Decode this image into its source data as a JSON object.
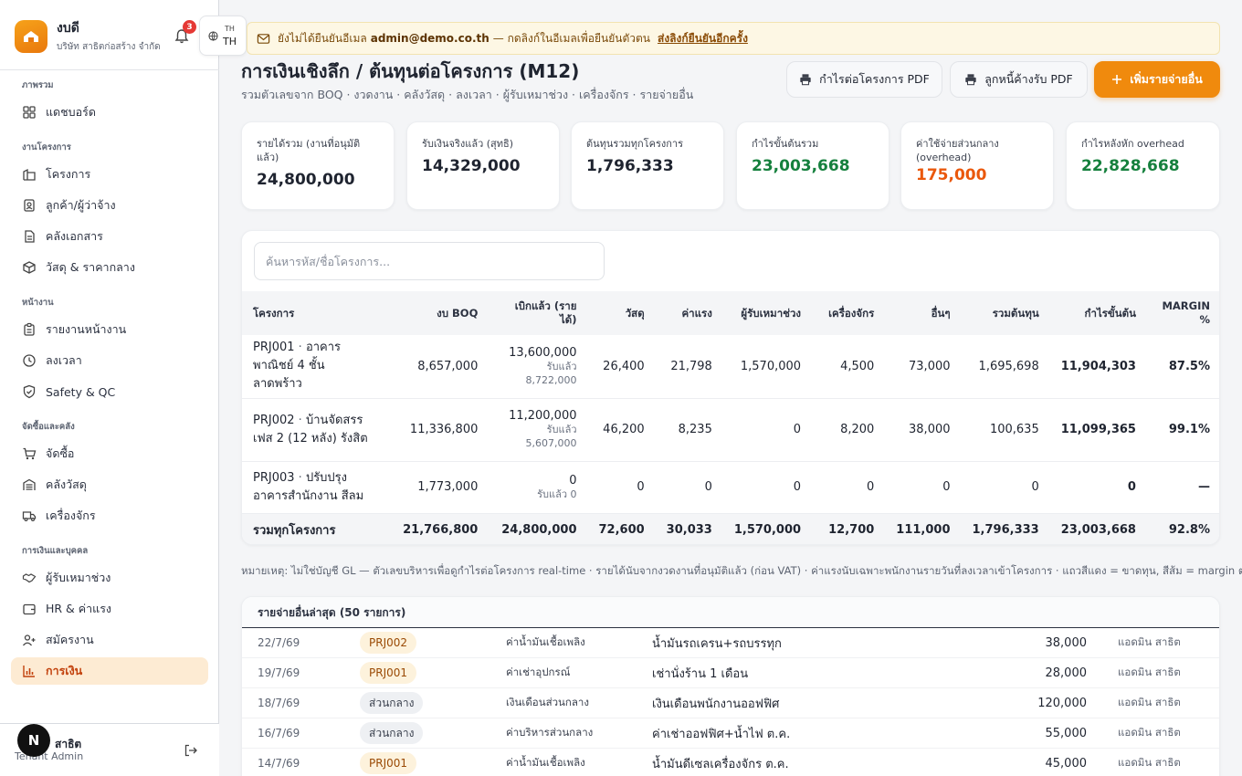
{
  "brand": {
    "name": "งบดี",
    "company": "บริษัท สาธิตก่อสร้าง จำกัด",
    "notification_count": "3"
  },
  "lang": {
    "top": "TH",
    "main": "TH"
  },
  "banner": {
    "text_before": "ยังไม่ได้ยืนยันอีเมล",
    "email": "admin@demo.co.th",
    "text_after": "— กดลิงก์ในอีเมลเพื่อยืนยันตัวตน",
    "link": "ส่งลิงก์ยืนยันอีกครั้ง"
  },
  "sidebar": {
    "sections": {
      "overview": "ภาพรวม",
      "projects": "งานโครงการ",
      "site": "หน้างาน",
      "procurement": "จัดซื้อและคลัง",
      "finance": "การเงินและบุคคล"
    },
    "items": {
      "dashboard": "แดชบอร์ด",
      "projects": "โครงการ",
      "clients": "ลูกค้า/ผู้ว่าจ้าง",
      "documents": "คลังเอกสาร",
      "materials": "วัสดุ & ราคากลาง",
      "daily_report": "รายงานหน้างาน",
      "timesheet": "ลงเวลา",
      "safety": "Safety & QC",
      "purchasing": "จัดซื้อ",
      "warehouse": "คลังวัสดุ",
      "machinery": "เครื่องจักร",
      "subcontractors": "ผู้รับเหมาช่วง",
      "hr": "HR & ค่าแรง",
      "recruit": "สมัครงาน",
      "finance": "การเงิน"
    },
    "user": {
      "initial": "N",
      "name": "สาธิต",
      "role": "Tenant Admin"
    }
  },
  "header": {
    "title": "การเงินเชิงลึก / ต้นทุนต่อโครงการ (M12)",
    "subtitle": "รวมตัวเลขจาก BOQ · งวดงาน · คลังวัสดุ · ลงเวลา · ผู้รับเหมาช่วง · เครื่องจักร · รายจ่ายอื่น",
    "btn_profit_pdf": "กำไรต่อโครงการ PDF",
    "btn_ar_pdf": "ลูกหนี้ค้างรับ PDF",
    "btn_add": "เพิ่มรายจ่ายอื่น"
  },
  "kpis": [
    {
      "label": "รายได้รวม (งานที่อนุมัติแล้ว)",
      "value": "24,800,000",
      "tone": ""
    },
    {
      "label": "รับเงินจริงแล้ว (สุทธิ)",
      "value": "14,329,000",
      "tone": ""
    },
    {
      "label": "ต้นทุนรวมทุกโครงการ",
      "value": "1,796,333",
      "tone": ""
    },
    {
      "label": "กำไรขั้นต้นรวม",
      "value": "23,003,668",
      "tone": "green"
    },
    {
      "label": "ค่าใช้จ่ายส่วนกลาง (overhead)",
      "value": "175,000",
      "tone": "orange"
    },
    {
      "label": "กำไรหลังหัก overhead",
      "value": "22,828,668",
      "tone": "green"
    }
  ],
  "search": {
    "placeholder": "ค้นหารหัส/ชื่อโครงการ..."
  },
  "table": {
    "headers": {
      "project": "โครงการ",
      "boq": "งบ BOQ",
      "billed": "เบิกแล้ว (รายได้)",
      "material": "วัสดุ",
      "labor": "ค่าแรง",
      "sub": "ผู้รับเหมาช่วง",
      "machine": "เครื่องจักร",
      "other": "อื่นๆ",
      "total_cost": "รวมต้นทุน",
      "gross": "กำไรขั้นต้น",
      "margin": "MARGIN %"
    },
    "rows": [
      {
        "code": "PRJ001",
        "name": "อาคารพาณิชย์ 4 ชั้น ลาดพร้าว",
        "boq": "8,657,000",
        "billed": "13,600,000",
        "received": "รับแล้ว 8,722,000",
        "material": "26,400",
        "labor": "21,798",
        "sub": "1,570,000",
        "machine": "4,500",
        "other": "73,000",
        "total_cost": "1,695,698",
        "gross": "11,904,303",
        "margin": "87.5%"
      },
      {
        "code": "PRJ002",
        "name": "บ้านจัดสรร เฟส 2 (12 หลัง) รังสิต",
        "boq": "11,336,800",
        "billed": "11,200,000",
        "received": "รับแล้ว 5,607,000",
        "material": "46,200",
        "labor": "8,235",
        "sub": "0",
        "machine": "8,200",
        "other": "38,000",
        "total_cost": "100,635",
        "gross": "11,099,365",
        "margin": "99.1%"
      },
      {
        "code": "PRJ003",
        "name": "ปรับปรุงอาคารสำนักงาน สีลม",
        "boq": "1,773,000",
        "billed": "0",
        "received": "รับแล้ว 0",
        "material": "0",
        "labor": "0",
        "sub": "0",
        "machine": "0",
        "other": "0",
        "total_cost": "0",
        "gross": "0",
        "margin": "—"
      }
    ],
    "total": {
      "label": "รวมทุกโครงการ",
      "boq": "21,766,800",
      "billed": "24,800,000",
      "material": "72,600",
      "labor": "30,033",
      "sub": "1,570,000",
      "machine": "12,700",
      "other": "111,000",
      "total_cost": "1,796,333",
      "gross": "23,003,668",
      "margin": "92.8%"
    }
  },
  "note": "หมายเหตุ: ไม่ใช่บัญชี GL — ตัวเลขบริหารเพื่อดูกำไรต่อโครงการ real-time · รายได้นับจากงวดงานที่อนุมัติแล้ว (ก่อน VAT) · ค่าแรงนับเฉพาะพนักงานรายวันที่ลงเวลาเข้าโครงการ · แถวสีแดง = ขาดทุน, สีส้ม = margin ต่ำกว่า 10%",
  "expenses": {
    "title": "รายจ่ายอื่นล่าสุด (50 รายการ)",
    "rows": [
      {
        "date": "22/7/69",
        "tag": "PRJ002",
        "tag_type": "proj",
        "category": "ค่าน้ำมันเชื้อเพลิง",
        "desc": "น้ำมันรถเครน+รถบรรทุก",
        "amount": "38,000",
        "user": "แอดมิน สาธิต"
      },
      {
        "date": "19/7/69",
        "tag": "PRJ001",
        "tag_type": "proj",
        "category": "ค่าเช่าอุปกรณ์",
        "desc": "เช่านั่งร้าน 1 เดือน",
        "amount": "28,000",
        "user": "แอดมิน สาธิต"
      },
      {
        "date": "18/7/69",
        "tag": "ส่วนกลาง",
        "tag_type": "mid",
        "category": "เงินเดือนส่วนกลาง",
        "desc": "เงินเดือนพนักงานออฟฟิศ",
        "amount": "120,000",
        "user": "แอดมิน สาธิต"
      },
      {
        "date": "16/7/69",
        "tag": "ส่วนกลาง",
        "tag_type": "mid",
        "category": "ค่าบริหารส่วนกลาง",
        "desc": "ค่าเช่าออฟฟิศ+น้ำไฟ ต.ค.",
        "amount": "55,000",
        "user": "แอดมิน สาธิต"
      },
      {
        "date": "14/7/69",
        "tag": "PRJ001",
        "tag_type": "proj",
        "category": "ค่าน้ำมันเชื้อเพลิง",
        "desc": "น้ำมันดีเซลเครื่องจักร ต.ค.",
        "amount": "45,000",
        "user": "แอดมิน สาธิต"
      }
    ]
  },
  "colors": {
    "accent": "#f08a0d",
    "green": "#15803d",
    "orange": "#ea580c",
    "active_bg": "#fdebd3"
  }
}
